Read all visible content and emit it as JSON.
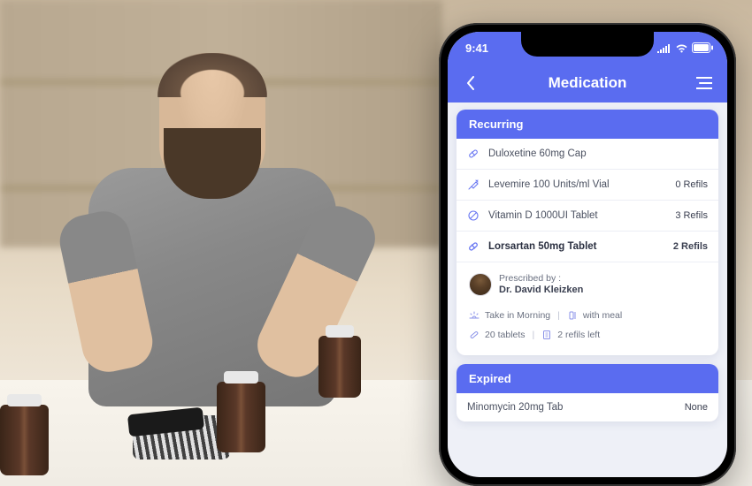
{
  "status": {
    "time": "9:41"
  },
  "header": {
    "title": "Medication"
  },
  "sections": {
    "recurring": {
      "title": "Recurring",
      "items": [
        {
          "name": "Duloxetine 60mg Cap",
          "refills": ""
        },
        {
          "name": "Levemire 100 Units/ml Vial",
          "refills": "0 Refils"
        },
        {
          "name": "Vitamin D 1000UI Tablet",
          "refills": "3 Refils"
        },
        {
          "name": "Lorsartan 50mg Tablet",
          "refills": "2 Refils"
        }
      ],
      "selected_detail": {
        "prescribed_by_label": "Prescribed by :",
        "doctor_name": "Dr. David Kleizken",
        "timing": "Take in Morning",
        "meal": "with meal",
        "quantity": "20 tablets",
        "refills_left": "2 refils left"
      }
    },
    "expired": {
      "title": "Expired",
      "items": [
        {
          "name": "Minomycin 20mg Tab",
          "refills": "None"
        }
      ]
    }
  }
}
